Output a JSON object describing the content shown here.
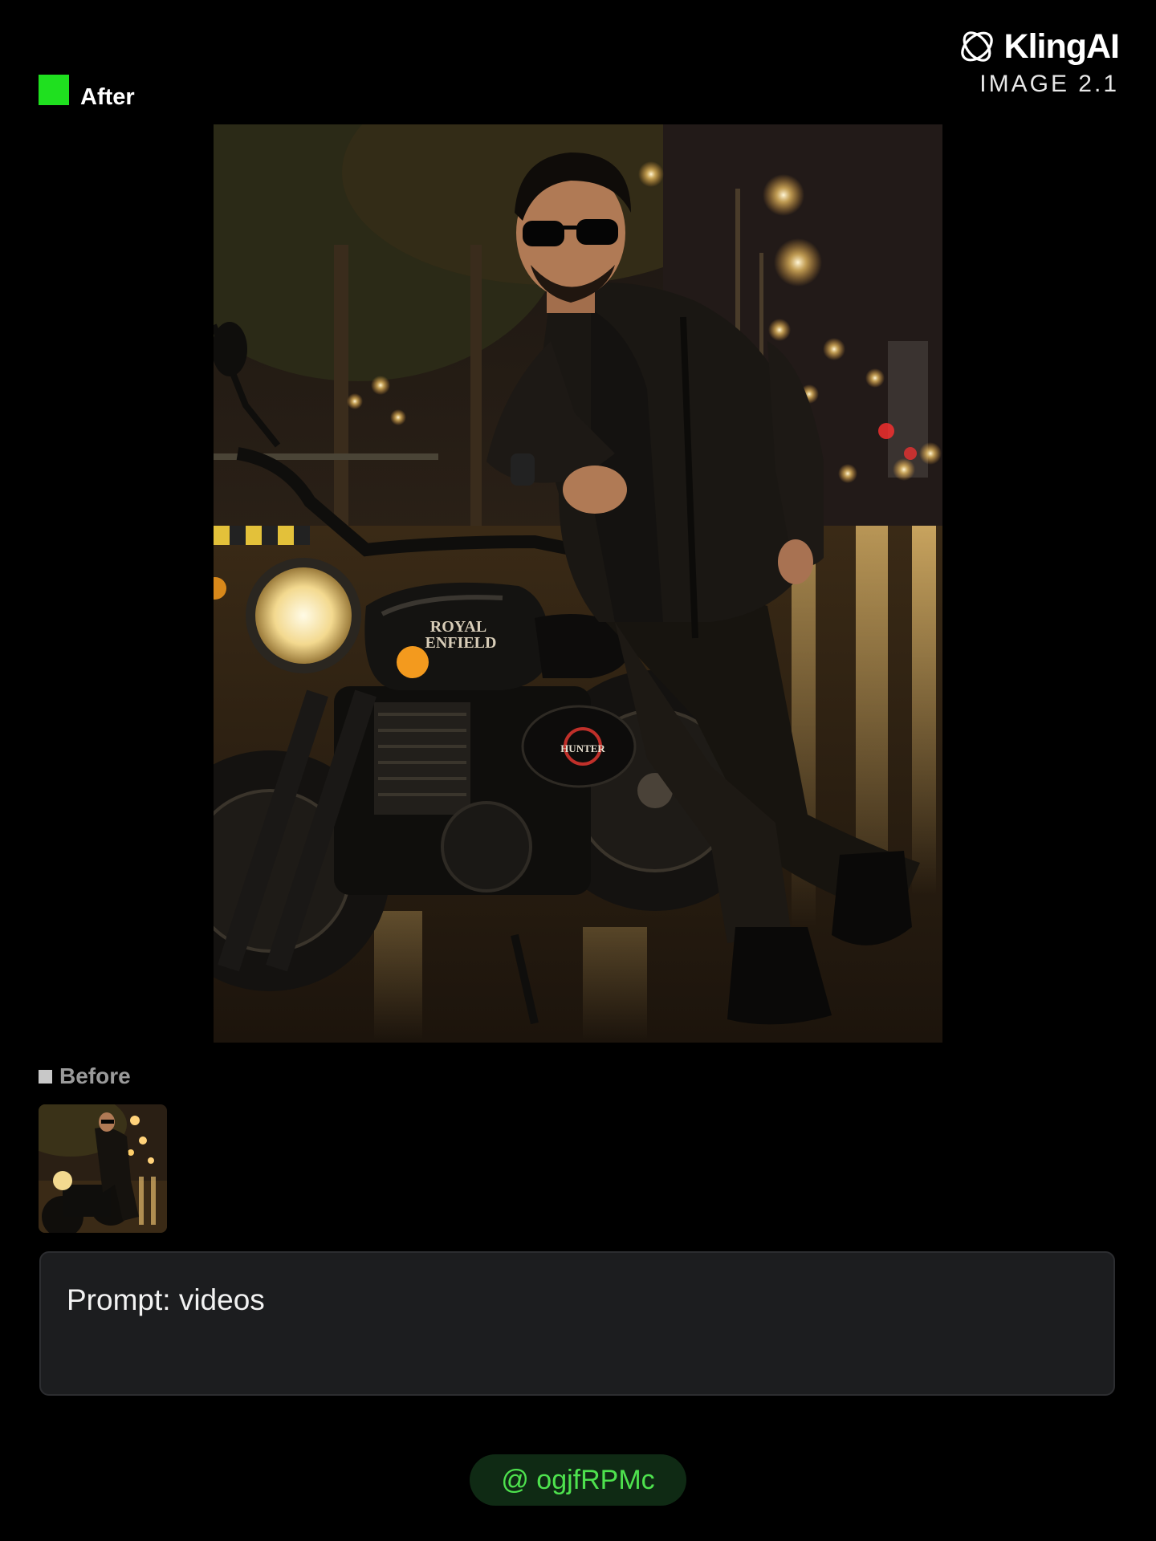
{
  "header": {
    "after_label": "After",
    "brand_name": "KlingAI",
    "brand_version": "IMAGE 2.1",
    "logo_icon": "kling-logo-icon",
    "after_swatch_color": "#1fe01f"
  },
  "main_image": {
    "tank_badge_line1": "ROYAL",
    "tank_badge_line2": "ENFIELD",
    "side_badge": "HUNTER"
  },
  "before": {
    "label": "Before",
    "swatch_color": "#c8c8c8"
  },
  "prompt": {
    "text": "Prompt: videos"
  },
  "footer": {
    "handle": "@ ogjfRPMc",
    "handle_color": "#4ee24e"
  }
}
